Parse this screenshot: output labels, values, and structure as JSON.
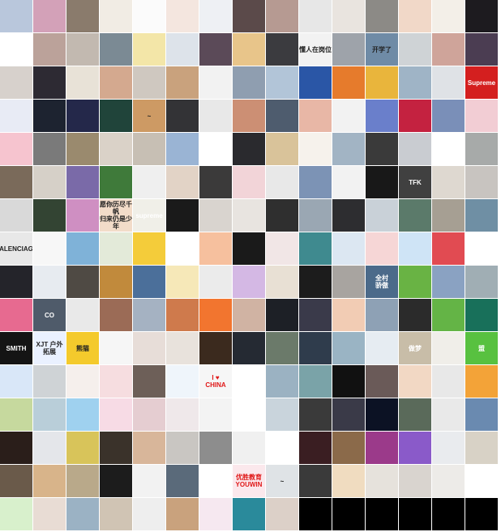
{
  "layout": {
    "cols": 15,
    "tile": 40,
    "gap": 1
  },
  "tiles": [
    [
      "#b9c7dc",
      "#d3a1b8",
      "#8a7b6c",
      "#f1ece4",
      "#fbfbfb",
      "#f4e6df",
      "#eef0f4",
      "#5b4a4a",
      "#b69a92",
      "#e7e7e7",
      "#e9e4df",
      "#8c8a86",
      "#f1d8c8",
      "#f3efe8",
      "#1d1b1f"
    ],
    [
      "#ffffff",
      "#bba29a",
      "#c2b9b0",
      "#7b8a94",
      "#f3e6a8",
      "#dde3ea",
      "#5b4a58",
      "#e8c58a",
      "#3b3b3f",
      "#f2f2f2",
      "#9ea3aa",
      "#6f8ba6",
      "#cfd3d6",
      "#cfa49a",
      "#4b3d52"
    ],
    [
      "#d7d1cc",
      "#2d2a33",
      "#e8e2d7",
      "#d4a98f",
      "#cfc8c0",
      "#c9a27d",
      "#f2f2f2",
      "#8f9eb0",
      "#b2c5d8",
      "#2a56a6",
      "#e67b2c",
      "#e9b53c",
      "#9fb4c6",
      "#dfe2e6",
      "#d41f1f"
    ],
    [
      "#e8ebf5",
      "#1d2330",
      "#24284a",
      "#20443a",
      "#cd9a64",
      "#333336",
      "#e8e8e8",
      "#cc8f74",
      "#4e5c6e",
      "#e8b7a6",
      "#f2f2f2",
      "#6a7fcb",
      "#c42240",
      "#7a8fb8",
      "#f2cdd4"
    ],
    [
      "#f6c4cf",
      "#7a7a7a",
      "#9a8a6e",
      "#dad2c8",
      "#c7bfb4",
      "#9ab4d4",
      "#ffffff",
      "#2a2a2e",
      "#d9c39a",
      "#f6f2ec",
      "#a2b4c4",
      "#3a3a3a",
      "#c9ccd1",
      "#ffffff",
      "#a7aaa9"
    ],
    [
      "#7a6a5a",
      "#d6d0c8",
      "#7a6aa8",
      "#3f7a3a",
      "#efefef",
      "#e2d3c6",
      "#3b3a3a",
      "#f2d4d8",
      "#e8e8e8",
      "#7c93b5",
      "#f2f2f2",
      "#181818",
      "#404040",
      "#ded8d0",
      "#c8c4c0"
    ],
    [
      "#d9d9d9",
      "#334433",
      "#cf8fc2",
      "#f2dcc9",
      "#f0efe8",
      "#1a1a1a",
      "#d9d4cf",
      "#e8e4e0",
      "#2f2f2f",
      "#9aa7b3",
      "#2d2d30",
      "#c9d1d8",
      "#5b7a6a",
      "#a69f93",
      "#6f8fa4"
    ],
    [
      "#e8e8e8",
      "#f7f7f7",
      "#7fb2d8",
      "#e3ead9",
      "#f4cc3a",
      "#ffffff",
      "#f6c09e",
      "#1a1a1a",
      "#f1e6e6",
      "#3f8a8f",
      "#dce7f2",
      "#f6d6d6",
      "#cfe4f6",
      "#e14b52",
      "#ffffff"
    ],
    [
      "#24242a",
      "#e7ebf0",
      "#4f4a44",
      "#c18a3c",
      "#4b6f9a",
      "#f6e8b8",
      "#ebebeb",
      "#d4b8e4",
      "#e8e0d4",
      "#1c1c1c",
      "#a8a4a0",
      "#4b6a8a",
      "#69b344",
      "#8aa2c2",
      "#a0aeb4"
    ],
    [
      "#e76a90",
      "#4f5b6a",
      "#e9e9e9",
      "#9b6b56",
      "#a5b2c2",
      "#cf7a4c",
      "#f2752f",
      "#d0b3a3",
      "#1d2026",
      "#3a3a4a",
      "#f2ccb4",
      "#8ea1b5",
      "#2b2b2b",
      "#64b446",
      "#18705a"
    ],
    [
      "#141414",
      "#eaf1ff",
      "#f4ca2c",
      "#f6f6f6",
      "#e7ddd8",
      "#e8e2dc",
      "#3b2a1e",
      "#252a33",
      "#6b7a6a",
      "#2f3c4c",
      "#9ab4c4",
      "#e6ecf2",
      "#c8bda8",
      "#f0eee9",
      "#58c140"
    ],
    [
      "#d9e7f8",
      "#cfd3d6",
      "#f5efec",
      "#f6dde0",
      "#6d5f58",
      "#eff5fb",
      "#f6f6f6",
      "#ffffff",
      "#9bb2c2",
      "#7aa3a8",
      "#111111",
      "#6a5a58",
      "#f2d8c4",
      "#e8e8e8",
      "#f3a338"
    ],
    [
      "#c6d99e",
      "#b9ced9",
      "#9fd1ef",
      "#f7dbe5",
      "#e5cdd1",
      "#efe8ea",
      "#f3f3f3",
      "#ffffff",
      "#c9d4dc",
      "#3a3a3a",
      "#3a3a48",
      "#0c1224",
      "#5a6a5a",
      "#e9e9e9",
      "#6a8ab0"
    ],
    [
      "#2a1e1a",
      "#e4e6ea",
      "#d8c45a",
      "#3a322a",
      "#d8b69a",
      "#c9c6c2",
      "#8d8d8d",
      "#f0f0f0",
      "#ffffff",
      "#3a1e22",
      "#8b6a4a",
      "#9b3a8a",
      "#8a5ac9",
      "#e9ebee",
      "#d8d2c6"
    ],
    [
      "#6a5a4a",
      "#d8b48a",
      "#b9a98a",
      "#1c1c1c",
      "#f2f2f2",
      "#5a6a7a",
      "#ffffff",
      "#fbe8ec",
      "#dfe3e6",
      "#3a3a3a",
      "#f0dcc0",
      "#e6e2dc",
      "#d9d4cf",
      "#edebe8",
      "#ffffff"
    ],
    [
      "#d8f0cc",
      "#e8dcd4",
      "#9bb2c4",
      "#d0c4b4",
      "#eeeeee",
      "#c9a27d",
      "#f6e8f0",
      "#2a8a9b",
      "#dcd0c8",
      "#000000",
      "#000000",
      "#000000",
      "#000000",
      "#000000",
      "#000000"
    ]
  ],
  "labels": [
    {
      "row": 1,
      "col": 9,
      "text": "懂人在岗位",
      "style": "dark"
    },
    {
      "row": 1,
      "col": 11,
      "text": "开学了",
      "style": "dark"
    },
    {
      "row": 2,
      "col": 14,
      "text": "Supreme",
      "style": ""
    },
    {
      "row": 3,
      "col": 4,
      "text": "~",
      "style": "dark"
    },
    {
      "row": 5,
      "col": 12,
      "text": "TFK",
      "style": ""
    },
    {
      "row": 6,
      "col": 3,
      "text": "愿你历尽千帆\n归来仍是少年",
      "style": "dark"
    },
    {
      "row": 6,
      "col": 4,
      "text": "supreme",
      "style": ""
    },
    {
      "row": 7,
      "col": 0,
      "text": "BALENCIAGA",
      "style": "dark"
    },
    {
      "row": 8,
      "col": 11,
      "text": "全村\n骄傲",
      "style": ""
    },
    {
      "row": 9,
      "col": 1,
      "text": "CO",
      "style": ""
    },
    {
      "row": 10,
      "col": 0,
      "text": "SMITH",
      "style": ""
    },
    {
      "row": 10,
      "col": 1,
      "text": "XJT 户外拓展",
      "style": "dark"
    },
    {
      "row": 10,
      "col": 2,
      "text": "熊猫",
      "style": "dark"
    },
    {
      "row": 10,
      "col": 12,
      "text": "做梦",
      "style": ""
    },
    {
      "row": 10,
      "col": 14,
      "text": "盟",
      "style": ""
    },
    {
      "row": 11,
      "col": 6,
      "text": "I ♥\nCHINA",
      "style": "red"
    },
    {
      "row": 14,
      "col": 7,
      "text": "优胜教育\nYOUWIN",
      "style": "red"
    },
    {
      "row": 14,
      "col": 8,
      "text": "~",
      "style": "dark"
    }
  ]
}
